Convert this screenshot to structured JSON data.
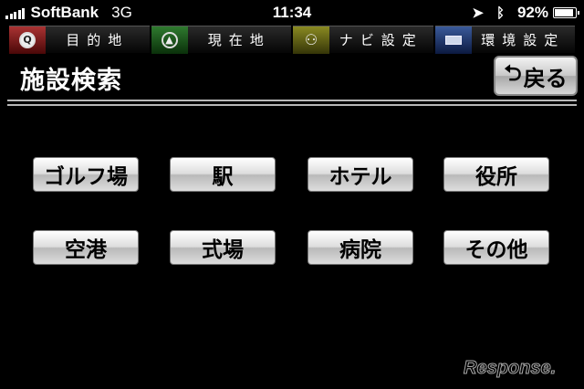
{
  "status_bar": {
    "carrier": "SoftBank",
    "network": "3G",
    "time": "11:34",
    "battery": "92%",
    "battery_level": 0.92,
    "icons": [
      "signal-bars-icon",
      "location-arrow-icon",
      "bluetooth-icon",
      "battery-icon"
    ]
  },
  "tabs": [
    {
      "label": "目的地",
      "icon": "magnifier-icon",
      "color": "#a33333"
    },
    {
      "label": "現在地",
      "icon": "compass-arrow-icon",
      "color": "#2f7a2f"
    },
    {
      "label": "ナビ設定",
      "icon": "route-icon",
      "color": "#8a8a22"
    },
    {
      "label": "環境設定",
      "icon": "screen-settings-icon",
      "color": "#3a5a9a"
    }
  ],
  "header": {
    "title": "施設検索",
    "back_label": "戻る"
  },
  "facilities": [
    {
      "label": "ゴルフ場"
    },
    {
      "label": "駅"
    },
    {
      "label": "ホテル"
    },
    {
      "label": "役所"
    },
    {
      "label": "空港"
    },
    {
      "label": "式場"
    },
    {
      "label": "病院"
    },
    {
      "label": "その他"
    }
  ],
  "watermark": "Response."
}
